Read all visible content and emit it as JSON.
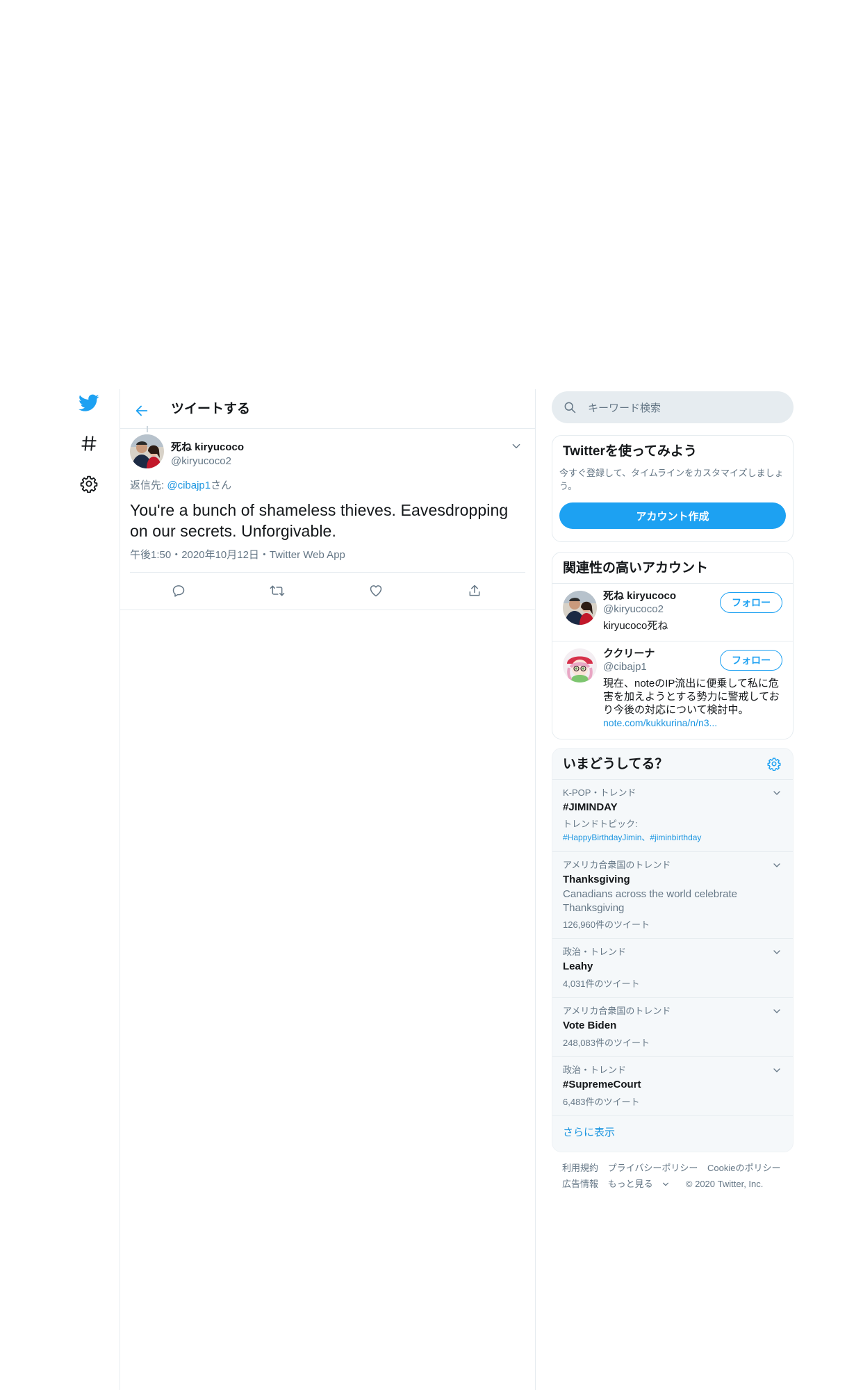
{
  "nav": {
    "logo": "twitter-bird-icon",
    "explore": "hashtag-icon",
    "settings": "gear-icon"
  },
  "header": {
    "title": "ツイートする"
  },
  "tweet": {
    "author_name": "死ね kiryucoco",
    "author_handle": "@kiryucoco2",
    "reply_prefix": "返信先: ",
    "reply_to": "@cibajp1",
    "reply_suffix": "さん",
    "text": "You're a bunch of shameless thieves. Eavesdropping on our secrets. Unforgivable.",
    "meta": "午後1:50・2020年10月12日・Twitter Web App"
  },
  "search": {
    "placeholder": "キーワード検索"
  },
  "signup": {
    "title": "Twitterを使ってみよう",
    "description": "今すぐ登録して、タイムラインをカスタマイズしましょう。",
    "button": "アカウント作成"
  },
  "related": {
    "title": "関連性の高いアカウント",
    "follow_label": "フォロー",
    "accounts": [
      {
        "name": "死ね kiryucoco",
        "handle": "@kiryucoco2",
        "bio": "kiryucoco死ね",
        "link": ""
      },
      {
        "name": "ククリーナ",
        "handle": "@cibajp1",
        "bio": "現在、noteのIP流出に便乗して私に危害を加えようとする勢力に警戒しており今後の対応について検討中。",
        "link": "note.com/kukkurina/n/n3..."
      }
    ]
  },
  "trends": {
    "title": "いまどうしてる？",
    "more": "さらに表示",
    "items": [
      {
        "context": "K-POP・トレンド",
        "name": "#JIMINDAY",
        "topic_label": "トレンドトピック:",
        "topics": "#HappyBirthdayJimin、#jiminbirthday"
      },
      {
        "context": "アメリカ合衆国のトレンド",
        "name": "Thanksgiving",
        "description": "Canadians across the world celebrate Thanksgiving",
        "count": "126,960件のツイート"
      },
      {
        "context": "政治・トレンド",
        "name": "Leahy",
        "count": "4,031件のツイート"
      },
      {
        "context": "アメリカ合衆国のトレンド",
        "name": "Vote Biden",
        "count": "248,083件のツイート"
      },
      {
        "context": "政治・トレンド",
        "name": "#SupremeCourt",
        "count": "6,483件のツイート"
      }
    ]
  },
  "footer": {
    "links": [
      "利用規約",
      "プライバシーポリシー",
      "Cookieのポリシー",
      "広告情報",
      "もっと見る"
    ],
    "copyright": "© 2020 Twitter, Inc."
  },
  "colors": {
    "accent": "#1da1f2",
    "link": "#1b95e0",
    "muted": "#657786",
    "border": "#e6ecf0",
    "panel": "#f5f8fa"
  }
}
